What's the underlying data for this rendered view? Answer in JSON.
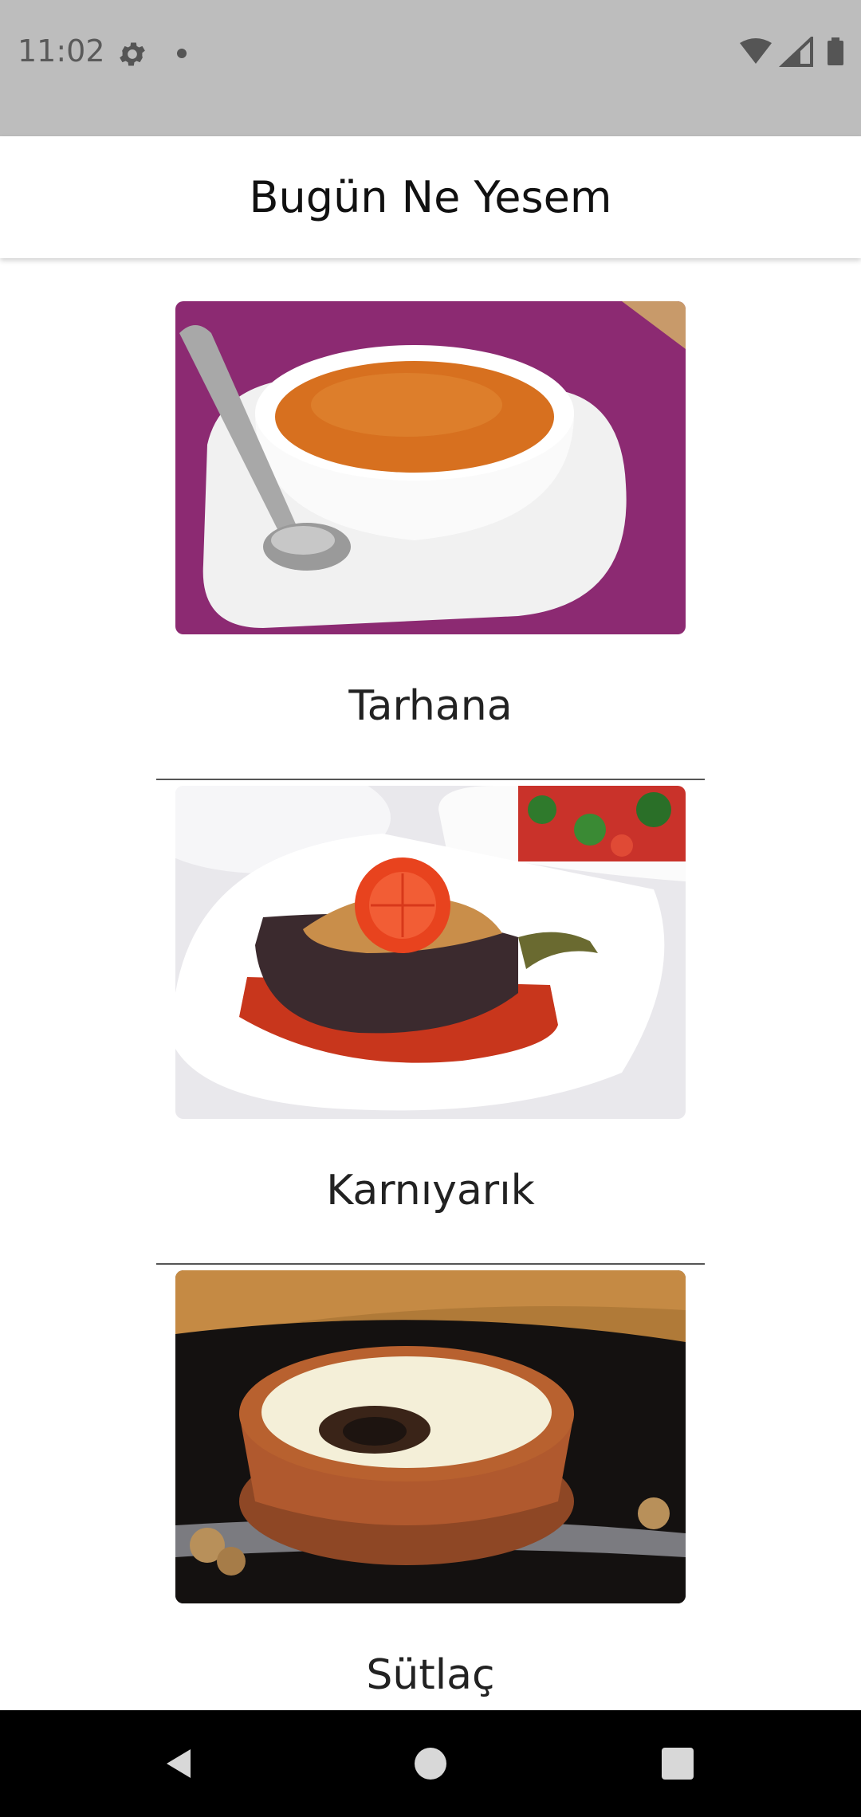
{
  "status_bar": {
    "time": "11:02",
    "icons": [
      "settings-icon",
      "notification-dot-icon",
      "wifi-icon",
      "signal-icon",
      "battery-icon"
    ]
  },
  "app_bar": {
    "title": "Bugün Ne Yesem"
  },
  "foods": [
    {
      "name": "Tarhana",
      "image": "tarhana-soup-image"
    },
    {
      "name": "Karnıyarık",
      "image": "karniyarik-eggplant-image"
    },
    {
      "name": "Sütlaç",
      "image": "sutlac-rice-pudding-image"
    }
  ],
  "nav_bar": {
    "icons": [
      "back-icon",
      "home-icon",
      "recents-icon"
    ]
  },
  "colors": {
    "status_bar": "#bdbdbd",
    "app_bar": "#ffffff",
    "nav_bar": "#000000"
  }
}
